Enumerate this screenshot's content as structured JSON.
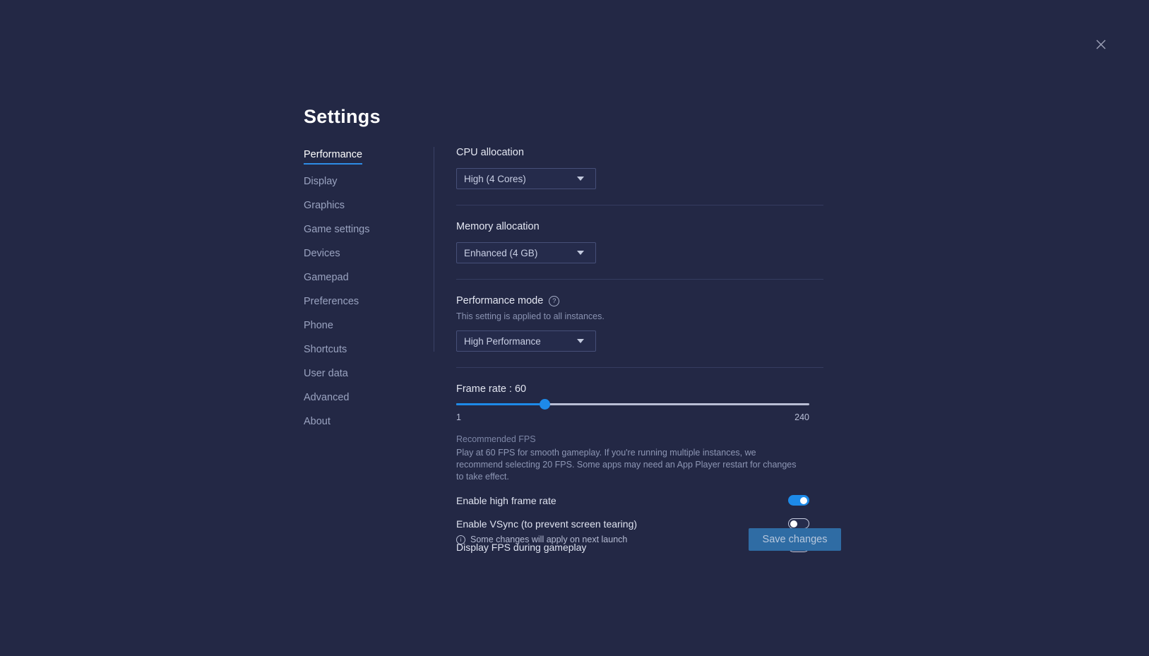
{
  "window": {
    "title": "Settings",
    "close_icon": "close-icon"
  },
  "sidebar": {
    "items": [
      {
        "label": "Performance",
        "active": true
      },
      {
        "label": "Display",
        "active": false
      },
      {
        "label": "Graphics",
        "active": false
      },
      {
        "label": "Game settings",
        "active": false
      },
      {
        "label": "Devices",
        "active": false
      },
      {
        "label": "Gamepad",
        "active": false
      },
      {
        "label": "Preferences",
        "active": false
      },
      {
        "label": "Phone",
        "active": false
      },
      {
        "label": "Shortcuts",
        "active": false
      },
      {
        "label": "User data",
        "active": false
      },
      {
        "label": "Advanced",
        "active": false
      },
      {
        "label": "About",
        "active": false
      }
    ]
  },
  "performance": {
    "cpu": {
      "label": "CPU allocation",
      "value": "High (4 Cores)"
    },
    "memory": {
      "label": "Memory allocation",
      "value": "Enhanced (4 GB)"
    },
    "mode": {
      "label": "Performance mode",
      "help_icon": "help-circle-icon",
      "description": "This setting is applied to all instances.",
      "value": "High Performance"
    },
    "frame_rate": {
      "label": "Frame rate : 60",
      "value": 60,
      "min": 1,
      "max": 240,
      "min_label": "1",
      "max_label": "240",
      "fill_percent": 25,
      "hint_title": "Recommended FPS",
      "hint_body": "Play at 60 FPS for smooth gameplay. If you're running multiple instances, we recommend selecting 20 FPS. Some apps may need an App Player restart for changes to take effect."
    },
    "toggles": [
      {
        "label": "Enable high frame rate",
        "on": true
      },
      {
        "label": "Enable VSync (to prevent screen tearing)",
        "on": false
      },
      {
        "label": "Display FPS during gameplay",
        "on": false
      }
    ]
  },
  "footer": {
    "note": "Some changes will apply on next launch",
    "info_icon": "info-circle-icon",
    "save_label": "Save changes"
  },
  "colors": {
    "background": "#232845",
    "accent": "#1d8ae8",
    "save_button": "#2f6ca4",
    "divider": "#353c60"
  }
}
